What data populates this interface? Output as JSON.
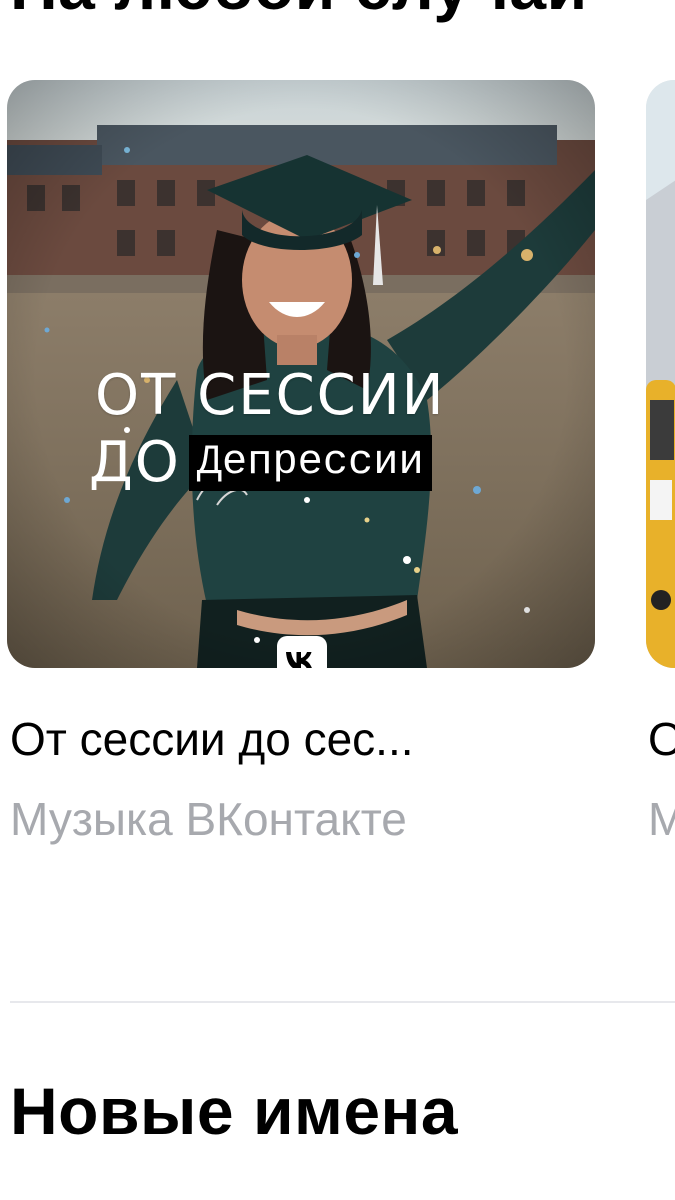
{
  "top_section": {
    "title": "На любой случай"
  },
  "playlists": [
    {
      "cover_text_line1": "ОТ СЕССИИ",
      "cover_text_do": "ДО",
      "cover_text_highlight": "Депрессии",
      "cover_badge_icon": "vk-logo-icon",
      "title": "От сессии до сес...",
      "subtitle": "Музыка ВКонтакте"
    },
    {
      "title": "О",
      "subtitle": "М"
    }
  ],
  "new_section": {
    "title": "Новые имена"
  },
  "colors": {
    "background": "#ffffff",
    "title_text": "#000000",
    "subtitle_text": "#a7a9ae",
    "divider": "#e7e8ec",
    "highlight_bg": "#000000"
  }
}
